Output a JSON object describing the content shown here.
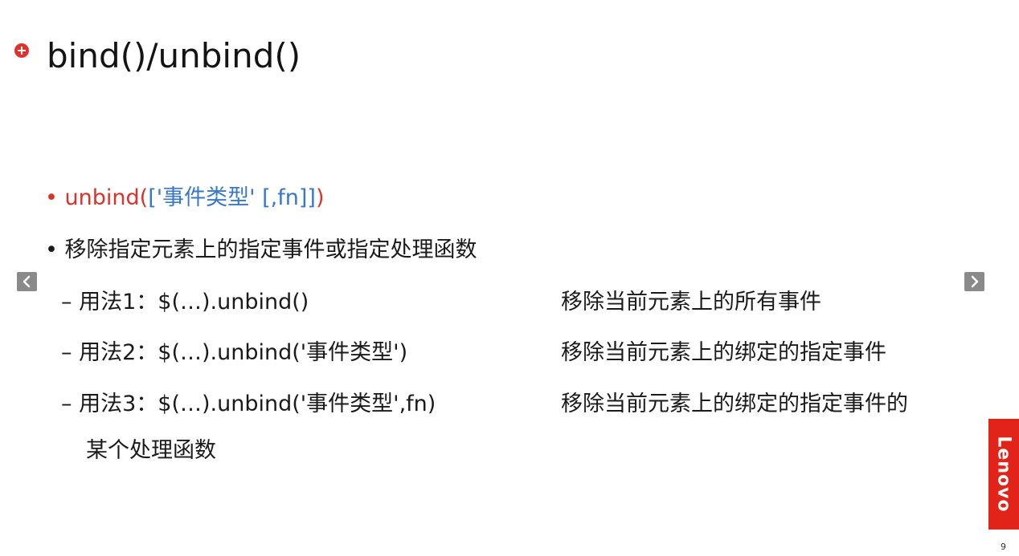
{
  "slide": {
    "title": "bind()/unbind()",
    "bullets": [
      {
        "marker": "•",
        "prefix": "unbind(",
        "args": "['事件类型' [,fn]]",
        "suffix": ")"
      },
      {
        "marker": "•",
        "text": "移除指定元素上的指定事件或指定处理函数"
      }
    ],
    "usages": [
      {
        "code": "– 用法1：$(…).unbind()",
        "desc": "移除当前元素上的所有事件"
      },
      {
        "code": "– 用法2：$(…).unbind('事件类型')",
        "desc": "移除当前元素上的绑定的指定事件"
      },
      {
        "code": "– 用法3：$(…).unbind('事件类型',fn)",
        "desc": "移除当前元素上的绑定的指定事件的"
      }
    ],
    "continuation": "某个处理函数"
  },
  "nav": {
    "prev_icon": "chevron-left-icon",
    "next_icon": "chevron-right-icon"
  },
  "logo": {
    "text": "Lenovo",
    "color": "#e2231a"
  },
  "page_number": "9",
  "colors": {
    "accent_red": "#d9342b",
    "accent_blue": "#3878c8"
  }
}
